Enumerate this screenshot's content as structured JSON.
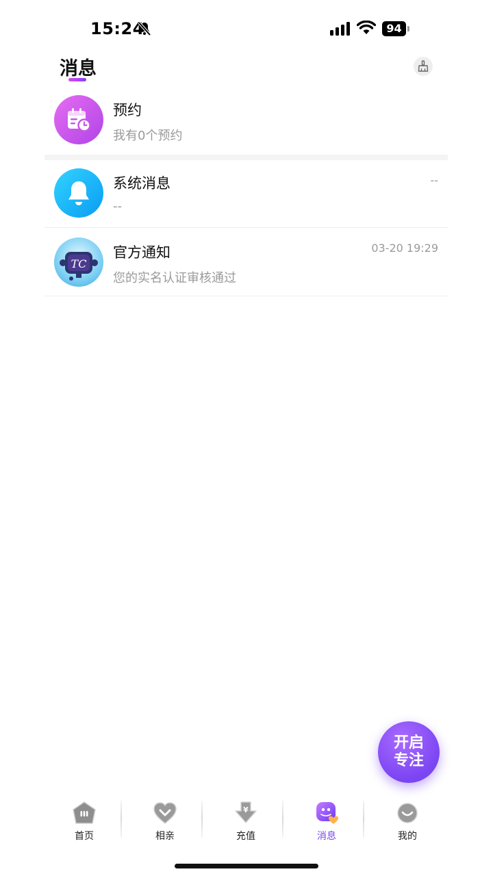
{
  "status_bar": {
    "time": "15:24",
    "battery": "94",
    "icons": [
      "bell-slash-icon",
      "signal-icon",
      "wifi-icon",
      "battery-icon"
    ]
  },
  "header": {
    "title": "消息",
    "clean_icon": "broom-icon"
  },
  "messages": [
    {
      "title": "预约",
      "subtitle": "我有0个预约",
      "time": "",
      "icon": "calendar-clock-icon"
    },
    {
      "title": "系统消息",
      "subtitle": "--",
      "time": "--",
      "icon": "bell-icon"
    },
    {
      "title": "官方通知",
      "subtitle": "您的实名认证审核通过",
      "time": "03-20 19:29",
      "icon": "tc-robot-avatar"
    }
  ],
  "fab": {
    "line1": "开启",
    "line2": "专注"
  },
  "tabs": [
    {
      "label": "首页",
      "icon": "home-icon",
      "active": false
    },
    {
      "label": "相亲",
      "icon": "heart-icon",
      "active": false
    },
    {
      "label": "充值",
      "icon": "yuan-icon",
      "active": false
    },
    {
      "label": "消息",
      "icon": "message-icon",
      "active": true
    },
    {
      "label": "我的",
      "icon": "profile-icon",
      "active": false
    }
  ],
  "colors": {
    "accent": "#7b45f2",
    "appointment_gradient": [
      "#e169f0",
      "#b147e8"
    ],
    "system_gradient": [
      "#2ed1ff",
      "#0a9ef5"
    ]
  }
}
